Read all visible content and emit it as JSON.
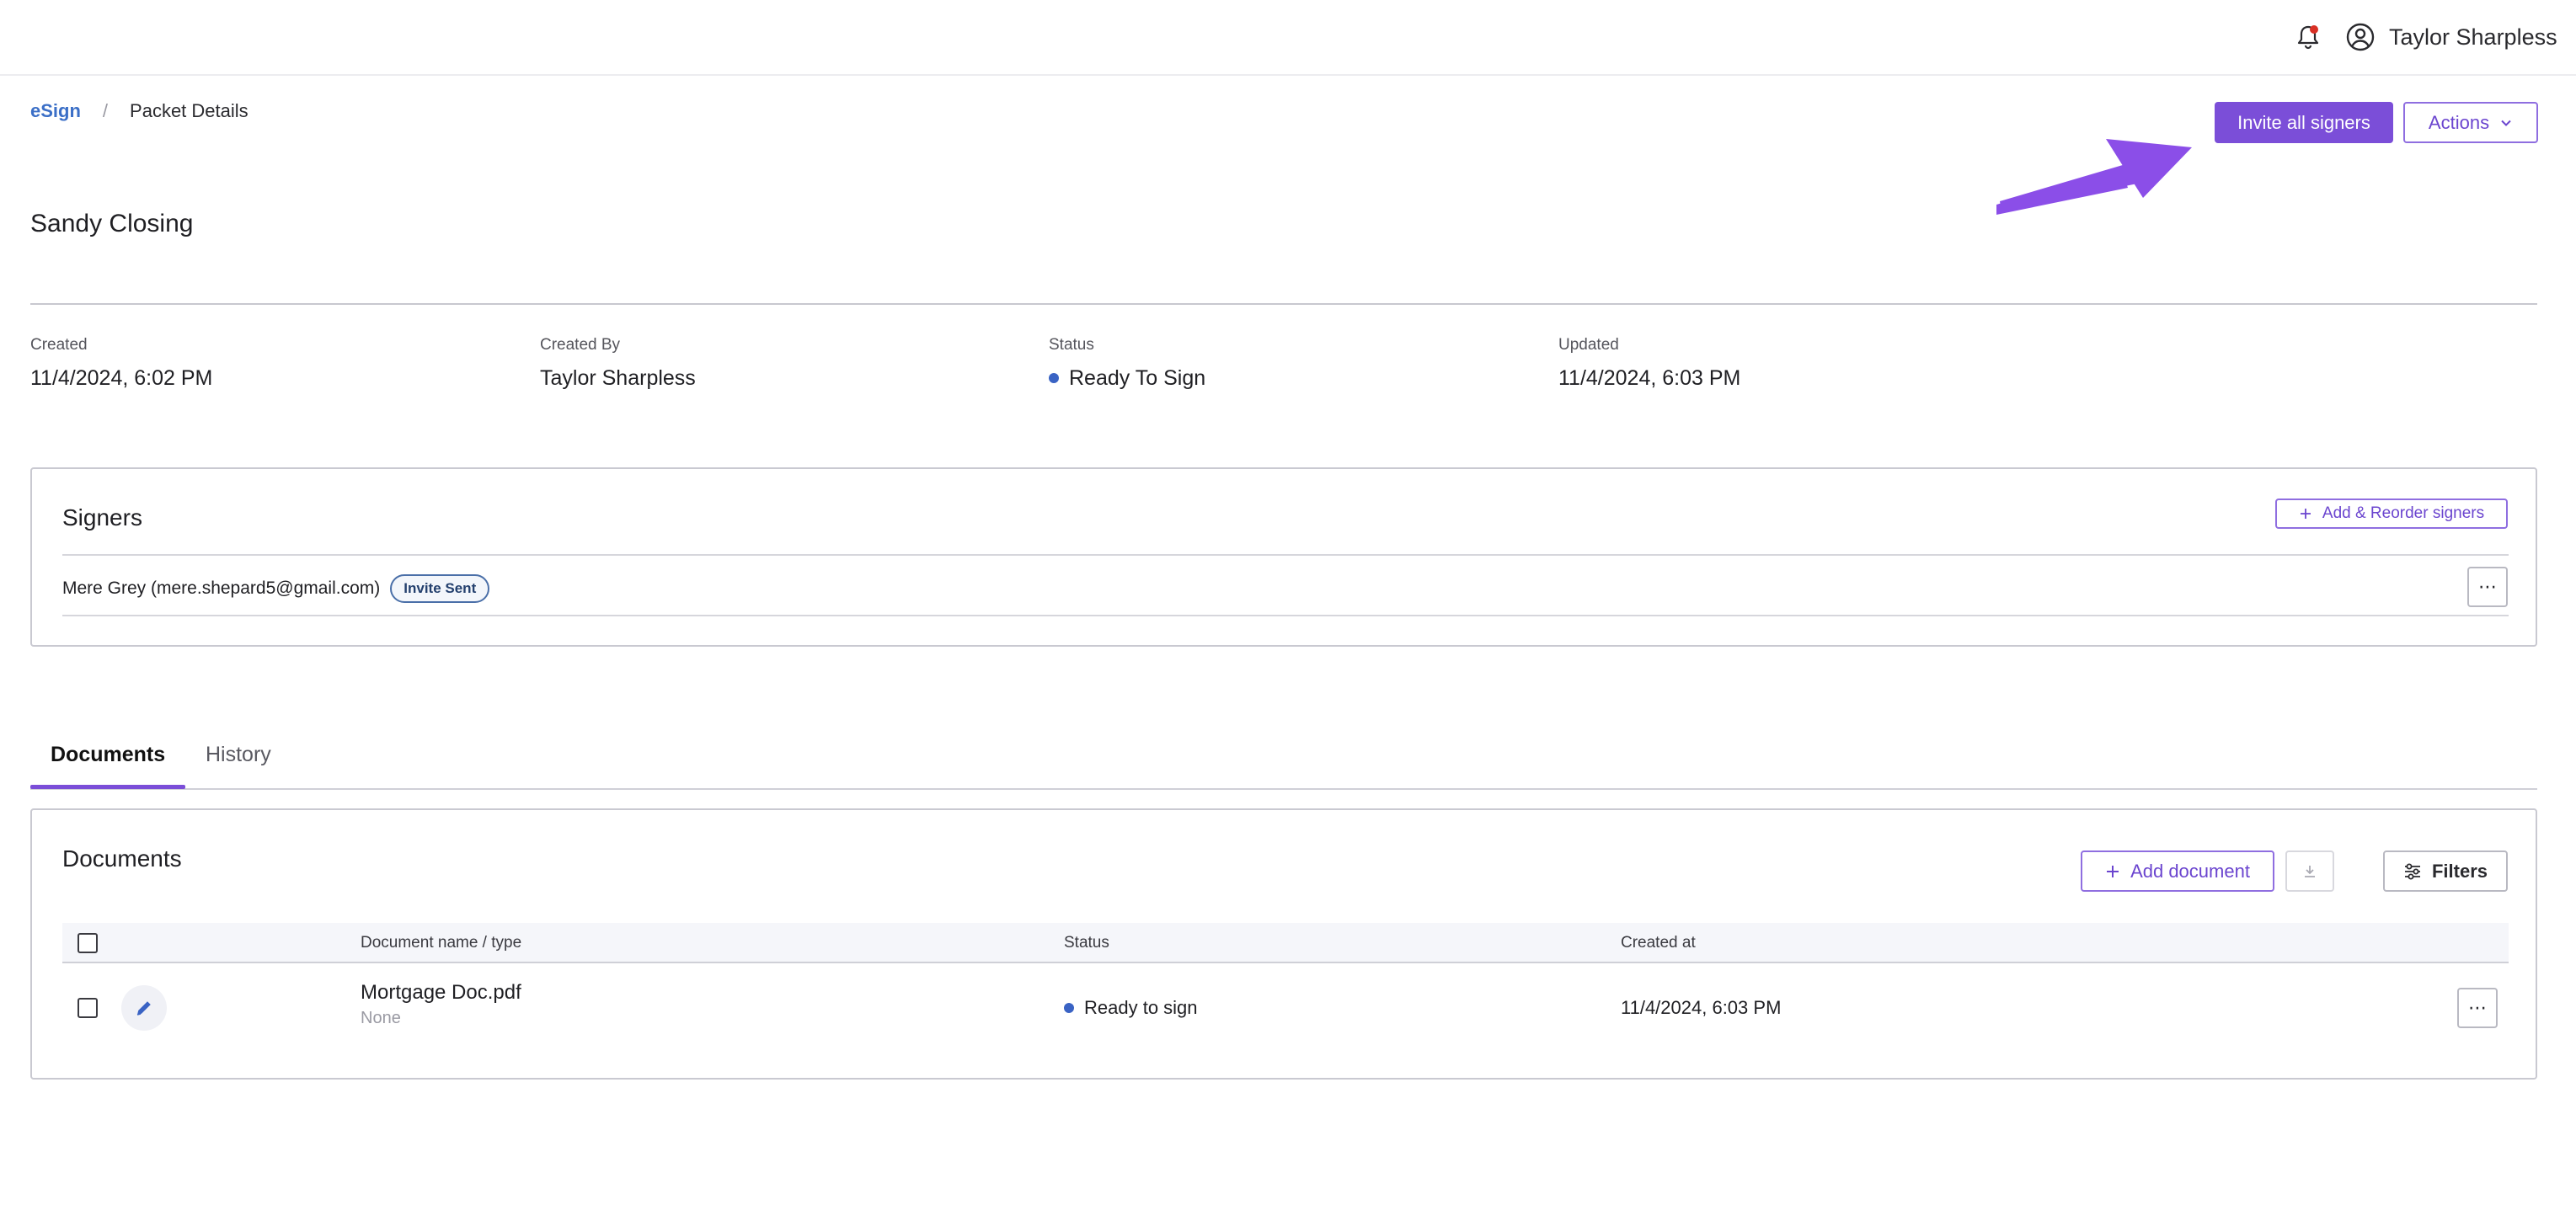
{
  "header": {
    "user_name": "Taylor Sharpless",
    "notification_dot_color": "#d93025"
  },
  "breadcrumb": {
    "root": "eSign",
    "separator": "/",
    "current": "Packet Details"
  },
  "actions": {
    "invite_all_label": "Invite all signers",
    "actions_label": "Actions"
  },
  "packet": {
    "title": "Sandy Closing",
    "meta": [
      {
        "label": "Created",
        "value": "11/4/2024, 6:02 PM"
      },
      {
        "label": "Created By",
        "value": "Taylor Sharpless"
      },
      {
        "label": "Status",
        "value": "Ready To Sign"
      },
      {
        "label": "Updated",
        "value": "11/4/2024, 6:03 PM"
      }
    ]
  },
  "signers": {
    "title": "Signers",
    "add_reorder_label": "Add & Reorder signers",
    "items": [
      {
        "name": "Mere Grey (mere.shepard5@gmail.com)",
        "badge": "Invite Sent"
      }
    ]
  },
  "tabs": [
    {
      "label": "Documents",
      "active": true
    },
    {
      "label": "History",
      "active": false
    }
  ],
  "documents": {
    "title": "Documents",
    "add_label": "Add document",
    "filters_label": "Filters",
    "columns": [
      "Document name / type",
      "Status",
      "Created at"
    ],
    "rows": [
      {
        "name": "Mortgage Doc.pdf",
        "type": "None",
        "status": "Ready to sign",
        "created_at": "11/4/2024, 6:03 PM"
      }
    ]
  },
  "colors": {
    "accent": "#7b4ed8",
    "status_dot": "#3a63c4",
    "link": "#3b6fc7"
  }
}
